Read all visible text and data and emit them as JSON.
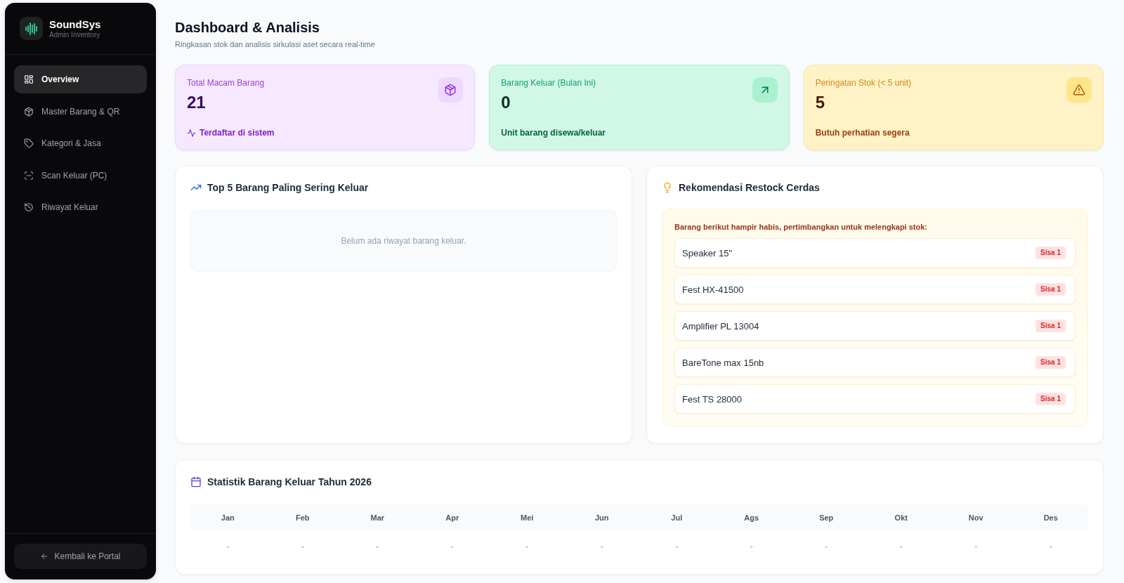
{
  "sidebar": {
    "brand": {
      "name": "SoundSys",
      "tagline": "Admin Inventory"
    },
    "nav": [
      {
        "label": "Overview",
        "selected": true
      },
      {
        "label": "Master Barang & QR",
        "selected": false
      },
      {
        "label": "Kategori & Jasa",
        "selected": false
      },
      {
        "label": "Scan Keluar (PC)",
        "selected": false
      },
      {
        "label": "Riwayat Keluar",
        "selected": false
      }
    ],
    "back_button": {
      "label": "Kembali ke Portal"
    }
  },
  "header": {
    "title": "Dashboard & Analisis",
    "subtitle": "Ringkasan stok dan analisis sirkulasi aset secara real-time"
  },
  "stat_cards": [
    {
      "label": "Total Macam Barang",
      "value": "21",
      "note": "Terdaftar di sistem"
    },
    {
      "label": "Barang Keluar (Bulan Ini)",
      "value": "0",
      "note": "Unit barang disewa/keluar"
    },
    {
      "label": "Peringatan Stok (< 5 unit)",
      "value": "5",
      "note": "Butuh perhatian segera"
    }
  ],
  "top_items": {
    "title": "Top 5 Barang Paling Sering Keluar",
    "empty_message": "Belum ada riwayat barang keluar."
  },
  "restock": {
    "title": "Rekomendasi Restock Cerdas",
    "intro": "Barang berikut hampir habis, pertimbangkan untuk melengkapi stok:",
    "items": [
      {
        "name": "Speaker 15\"",
        "badge": "Sisa 1"
      },
      {
        "name": "Fest HX-41500",
        "badge": "Sisa 1"
      },
      {
        "name": "Amplifier PL 13004",
        "badge": "Sisa 1"
      },
      {
        "name": "BareTone max 15nb",
        "badge": "Sisa 1"
      },
      {
        "name": "Fest TS 28000",
        "badge": "Sisa 1"
      }
    ]
  },
  "monthly_stats": {
    "title": "Statistik Barang Keluar Tahun 2026",
    "table": {
      "columns": [
        "Jan",
        "Feb",
        "Mar",
        "Apr",
        "Mei",
        "Jun",
        "Jul",
        "Ags",
        "Sep",
        "Okt",
        "Nov",
        "Des"
      ],
      "rows": [
        [
          "-",
          "-",
          "-",
          "-",
          "-",
          "-",
          "-",
          "-",
          "-",
          "-",
          "-",
          "-"
        ]
      ]
    }
  }
}
